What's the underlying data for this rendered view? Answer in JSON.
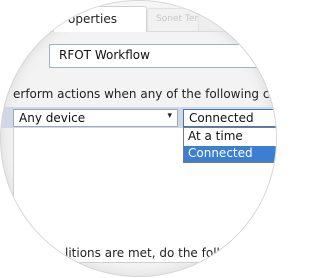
{
  "window": {
    "active_tab": "operties",
    "ghost_tab": "Sonet Ten"
  },
  "form": {
    "name_label": "e:",
    "name_value": "RFOT Workflow",
    "instruction": "erform actions when any of the following co",
    "device_select": {
      "value": "Any device",
      "arrow": "▾"
    },
    "state_select": {
      "value": "Connected",
      "options": [
        "At a time",
        "Connected"
      ],
      "highlighted": "Connected"
    },
    "bottom_text": "litions are met, do the foll"
  },
  "colors": {
    "row_strip": "#cfd8e4",
    "selection": "#3c7fd1",
    "focus_border": "#3a78c8"
  }
}
